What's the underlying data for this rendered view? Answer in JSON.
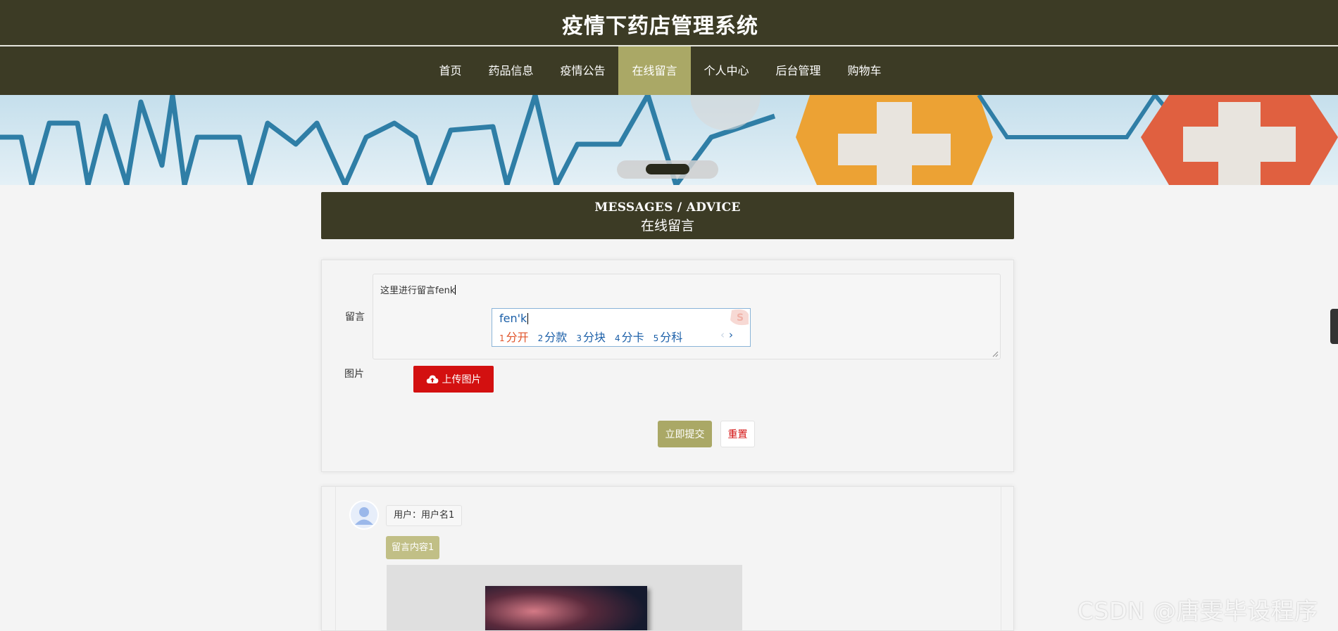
{
  "header": {
    "title": "疫情下药店管理系统"
  },
  "nav": {
    "items": [
      {
        "label": "首页"
      },
      {
        "label": "药品信息"
      },
      {
        "label": "疫情公告"
      },
      {
        "label": "在线留言"
      },
      {
        "label": "个人中心"
      },
      {
        "label": "后台管理"
      },
      {
        "label": "购物车"
      }
    ],
    "active_index": 3
  },
  "section": {
    "title_en": "MESSAGES / ADVICE",
    "title_cn": "在线留言"
  },
  "form": {
    "message_label": "留言",
    "message_value": "这里进行留言fenk",
    "image_label": "图片",
    "upload_button": "上传图片",
    "submit_button": "立即提交",
    "reset_button": "重置"
  },
  "ime": {
    "pinyin": "fen'k",
    "candidates": [
      {
        "num": "1",
        "text": "分开"
      },
      {
        "num": "2",
        "text": "分款"
      },
      {
        "num": "3",
        "text": "分块"
      },
      {
        "num": "4",
        "text": "分卡"
      },
      {
        "num": "5",
        "text": "分科"
      }
    ],
    "prev_arrow": "‹",
    "next_arrow": "›"
  },
  "messages": [
    {
      "user": "用户：用户名1",
      "content": "留言内容1"
    }
  ],
  "watermark": "CSDN @唐雯毕设程序",
  "colors": {
    "header_bg": "#3c3b25",
    "accent": "#aaa866",
    "upload_red": "#d31010",
    "page_bg": "#f4f4f4"
  },
  "icons": [
    "cloud-upload-icon",
    "user-avatar-icon",
    "slider-dots"
  ]
}
